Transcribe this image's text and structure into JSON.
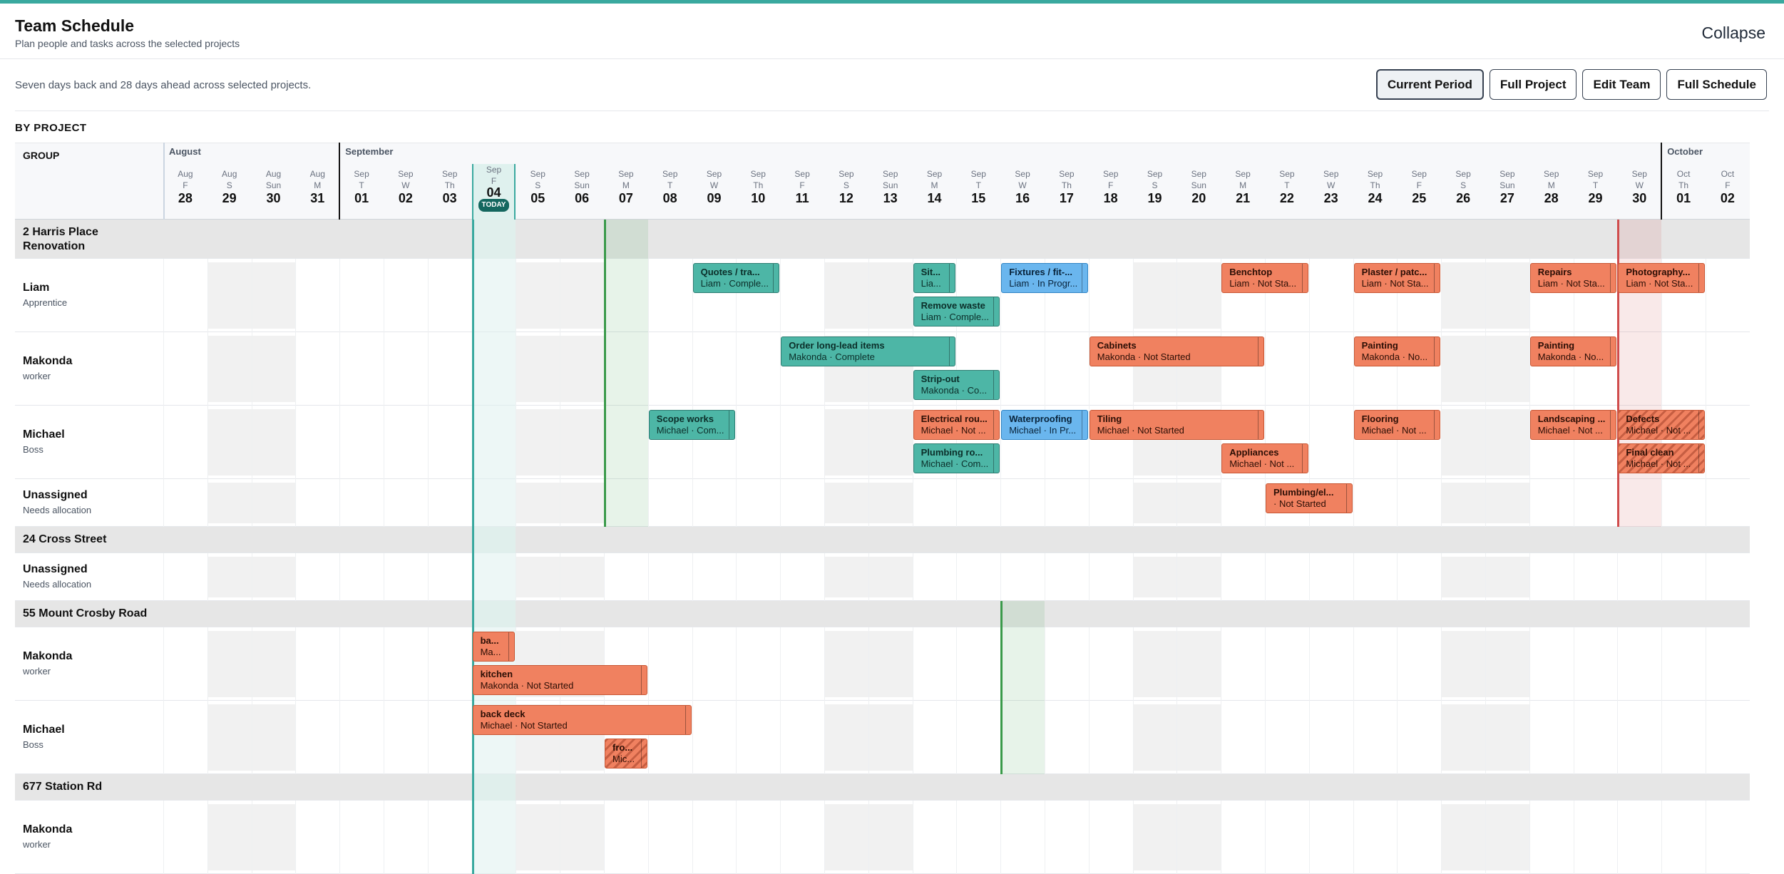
{
  "header": {
    "title": "Team Schedule",
    "subtitle": "Plan people and tasks across the selected projects",
    "collapse_label": "Collapse"
  },
  "toolbar": {
    "info": "Seven days back and 28 days ahead across selected projects.",
    "buttons": [
      "Current Period",
      "Full Project",
      "Edit Team",
      "Full Schedule"
    ],
    "active_button": "Current Period"
  },
  "section_label": "BY PROJECT",
  "group_col_label": "GROUP",
  "today_label": "TODAY",
  "months": [
    {
      "label": "August",
      "start": 0
    },
    {
      "label": "September",
      "start": 4
    },
    {
      "label": "October",
      "start": 34
    }
  ],
  "days": [
    {
      "m": "Aug",
      "w": "F",
      "d": "28"
    },
    {
      "m": "Aug",
      "w": "S",
      "d": "29"
    },
    {
      "m": "Aug",
      "w": "Sun",
      "d": "30"
    },
    {
      "m": "Aug",
      "w": "M",
      "d": "31"
    },
    {
      "m": "Sep",
      "w": "T",
      "d": "01"
    },
    {
      "m": "Sep",
      "w": "W",
      "d": "02"
    },
    {
      "m": "Sep",
      "w": "Th",
      "d": "03"
    },
    {
      "m": "Sep",
      "w": "F",
      "d": "04",
      "today": true
    },
    {
      "m": "Sep",
      "w": "S",
      "d": "05"
    },
    {
      "m": "Sep",
      "w": "Sun",
      "d": "06"
    },
    {
      "m": "Sep",
      "w": "M",
      "d": "07"
    },
    {
      "m": "Sep",
      "w": "T",
      "d": "08"
    },
    {
      "m": "Sep",
      "w": "W",
      "d": "09"
    },
    {
      "m": "Sep",
      "w": "Th",
      "d": "10"
    },
    {
      "m": "Sep",
      "w": "F",
      "d": "11"
    },
    {
      "m": "Sep",
      "w": "S",
      "d": "12"
    },
    {
      "m": "Sep",
      "w": "Sun",
      "d": "13"
    },
    {
      "m": "Sep",
      "w": "M",
      "d": "14"
    },
    {
      "m": "Sep",
      "w": "T",
      "d": "15"
    },
    {
      "m": "Sep",
      "w": "W",
      "d": "16"
    },
    {
      "m": "Sep",
      "w": "Th",
      "d": "17"
    },
    {
      "m": "Sep",
      "w": "F",
      "d": "18"
    },
    {
      "m": "Sep",
      "w": "S",
      "d": "19"
    },
    {
      "m": "Sep",
      "w": "Sun",
      "d": "20"
    },
    {
      "m": "Sep",
      "w": "M",
      "d": "21"
    },
    {
      "m": "Sep",
      "w": "T",
      "d": "22"
    },
    {
      "m": "Sep",
      "w": "W",
      "d": "23"
    },
    {
      "m": "Sep",
      "w": "Th",
      "d": "24"
    },
    {
      "m": "Sep",
      "w": "F",
      "d": "25"
    },
    {
      "m": "Sep",
      "w": "S",
      "d": "26"
    },
    {
      "m": "Sep",
      "w": "Sun",
      "d": "27"
    },
    {
      "m": "Sep",
      "w": "M",
      "d": "28"
    },
    {
      "m": "Sep",
      "w": "T",
      "d": "29"
    },
    {
      "m": "Sep",
      "w": "W",
      "d": "30"
    },
    {
      "m": "Oct",
      "w": "Th",
      "d": "01"
    },
    {
      "m": "Oct",
      "w": "F",
      "d": "02"
    }
  ],
  "today_index": 7,
  "weekend_cols": [
    1,
    2,
    8,
    9,
    15,
    16,
    22,
    23,
    29,
    30
  ],
  "rows": [
    {
      "type": "group",
      "name": "2 Harris Place Renovation",
      "marker": {
        "col": 10,
        "color": "#3a9a4a"
      },
      "deadline": {
        "col": 33,
        "color": "#d04c4c"
      }
    },
    {
      "type": "person",
      "name": "Liam",
      "role": "Apprentice",
      "lanes": 2,
      "bars": [
        {
          "title": "Quotes / tra...",
          "sub": "Liam · Comple...",
          "start": 12,
          "span": 2,
          "lane": 0,
          "color": "teal",
          "grip": true
        },
        {
          "title": "Sit...",
          "sub": "Lia...",
          "start": 17,
          "span": 1,
          "lane": 0,
          "color": "teal",
          "grip": true
        },
        {
          "title": "Remove waste",
          "sub": "Liam · Comple...",
          "start": 17,
          "span": 2,
          "lane": 1,
          "color": "teal",
          "grip": true
        },
        {
          "title": "Fixtures / fit-...",
          "sub": "Liam · In Progr...",
          "start": 19,
          "span": 2,
          "lane": 0,
          "color": "blue",
          "grip": true
        },
        {
          "title": "Benchtop",
          "sub": "Liam · Not Sta...",
          "start": 24,
          "span": 2,
          "lane": 0,
          "color": "orange",
          "grip": true
        },
        {
          "title": "Plaster / patc...",
          "sub": "Liam · Not Sta...",
          "start": 27,
          "span": 2,
          "lane": 0,
          "color": "orange",
          "grip": true
        },
        {
          "title": "Repairs",
          "sub": "Liam · Not Sta...",
          "start": 31,
          "span": 2,
          "lane": 0,
          "color": "orange",
          "grip": true
        },
        {
          "title": "Photography...",
          "sub": "Liam · Not Sta...",
          "start": 33,
          "span": 2,
          "lane": 0,
          "color": "orange",
          "grip": true
        }
      ]
    },
    {
      "type": "person",
      "name": "Makonda",
      "role": "worker",
      "lanes": 2,
      "bars": [
        {
          "title": "Order long-lead items",
          "sub": "Makonda · Complete",
          "start": 14,
          "span": 4,
          "lane": 0,
          "color": "teal",
          "grip": true
        },
        {
          "title": "Strip-out",
          "sub": "Makonda · Co...",
          "start": 17,
          "span": 2,
          "lane": 1,
          "color": "teal",
          "grip": true
        },
        {
          "title": "Cabinets",
          "sub": "Makonda · Not Started",
          "start": 21,
          "span": 4,
          "lane": 0,
          "color": "orange",
          "grip": true
        },
        {
          "title": "Painting",
          "sub": "Makonda · No...",
          "start": 27,
          "span": 2,
          "lane": 0,
          "color": "orange",
          "grip": true
        },
        {
          "title": "Painting",
          "sub": "Makonda · No...",
          "start": 31,
          "span": 2,
          "lane": 0,
          "color": "orange",
          "grip": true
        }
      ]
    },
    {
      "type": "person",
      "name": "Michael",
      "role": "Boss",
      "lanes": 2,
      "bars": [
        {
          "title": "Scope works",
          "sub": "Michael · Com...",
          "start": 11,
          "span": 2,
          "lane": 0,
          "color": "teal",
          "grip": true
        },
        {
          "title": "Electrical rou...",
          "sub": "Michael · Not ...",
          "start": 17,
          "span": 2,
          "lane": 0,
          "color": "orange",
          "grip": true
        },
        {
          "title": "Plumbing ro...",
          "sub": "Michael · Com...",
          "start": 17,
          "span": 2,
          "lane": 1,
          "color": "teal",
          "grip": true
        },
        {
          "title": "Waterproofing",
          "sub": "Michael · In Pr...",
          "start": 19,
          "span": 2,
          "lane": 0,
          "color": "blue",
          "grip": true
        },
        {
          "title": "Tiling",
          "sub": "Michael · Not Started",
          "start": 21,
          "span": 4,
          "lane": 0,
          "color": "orange",
          "grip": true
        },
        {
          "title": "Appliances",
          "sub": "Michael · Not ...",
          "start": 24,
          "span": 2,
          "lane": 1,
          "color": "orange",
          "grip": true
        },
        {
          "title": "Flooring",
          "sub": "Michael · Not ...",
          "start": 27,
          "span": 2,
          "lane": 0,
          "color": "orange",
          "grip": true
        },
        {
          "title": "Landscaping ...",
          "sub": "Michael · Not ...",
          "start": 31,
          "span": 2,
          "lane": 0,
          "color": "orange",
          "grip": true
        },
        {
          "title": "Defects",
          "sub": "Michael · Not ...",
          "start": 33,
          "span": 2,
          "lane": 0,
          "color": "orange",
          "grip": true,
          "hatched": true
        },
        {
          "title": "Final clean",
          "sub": "Michael · Not ...",
          "start": 33,
          "span": 2,
          "lane": 1,
          "color": "orange",
          "grip": true,
          "hatched": true
        }
      ]
    },
    {
      "type": "person",
      "name": "Unassigned",
      "role": "Needs allocation",
      "lanes": 1,
      "bars": [
        {
          "title": "Plumbing/el...",
          "sub": "· Not Started",
          "start": 25,
          "span": 2,
          "lane": 0,
          "color": "orange",
          "grip": true
        }
      ]
    },
    {
      "type": "group",
      "name": "24 Cross Street"
    },
    {
      "type": "person",
      "name": "Unassigned",
      "role": "Needs allocation",
      "lanes": 1,
      "bars": []
    },
    {
      "type": "group",
      "name": "55 Mount Crosby Road",
      "marker": {
        "col": 19,
        "color": "#3a9a4a"
      }
    },
    {
      "type": "person",
      "name": "Makonda",
      "role": "worker",
      "lanes": 2,
      "bars": [
        {
          "title": "ba...",
          "sub": "Ma...",
          "start": 7,
          "span": 1,
          "lane": 0,
          "color": "orange",
          "grip": true
        },
        {
          "title": "kitchen",
          "sub": "Makonda · Not Started",
          "start": 7,
          "span": 4,
          "lane": 1,
          "color": "orange",
          "grip": true
        }
      ]
    },
    {
      "type": "person",
      "name": "Michael",
      "role": "Boss",
      "lanes": 2,
      "bars": [
        {
          "title": "back deck",
          "sub": "Michael · Not Started",
          "start": 7,
          "span": 5,
          "lane": 0,
          "color": "orange",
          "grip": true
        },
        {
          "title": "fro...",
          "sub": "Mic...",
          "start": 10,
          "span": 1,
          "lane": 1,
          "color": "orange",
          "grip": true,
          "hatched": true
        }
      ]
    },
    {
      "type": "group",
      "name": "677 Station Rd"
    },
    {
      "type": "person",
      "name": "Makonda",
      "role": "worker",
      "lanes": 2,
      "bars": []
    }
  ]
}
